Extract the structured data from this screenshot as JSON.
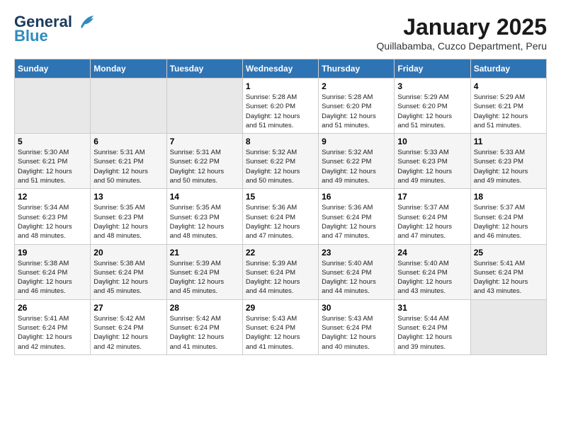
{
  "header": {
    "logo_line1": "General",
    "logo_line2": "Blue",
    "title": "January 2025",
    "subtitle": "Quillabamba, Cuzco Department, Peru"
  },
  "days_of_week": [
    "Sunday",
    "Monday",
    "Tuesday",
    "Wednesday",
    "Thursday",
    "Friday",
    "Saturday"
  ],
  "weeks": [
    [
      {
        "day": "",
        "info": ""
      },
      {
        "day": "",
        "info": ""
      },
      {
        "day": "",
        "info": ""
      },
      {
        "day": "1",
        "info": "Sunrise: 5:28 AM\nSunset: 6:20 PM\nDaylight: 12 hours\nand 51 minutes."
      },
      {
        "day": "2",
        "info": "Sunrise: 5:28 AM\nSunset: 6:20 PM\nDaylight: 12 hours\nand 51 minutes."
      },
      {
        "day": "3",
        "info": "Sunrise: 5:29 AM\nSunset: 6:20 PM\nDaylight: 12 hours\nand 51 minutes."
      },
      {
        "day": "4",
        "info": "Sunrise: 5:29 AM\nSunset: 6:21 PM\nDaylight: 12 hours\nand 51 minutes."
      }
    ],
    [
      {
        "day": "5",
        "info": "Sunrise: 5:30 AM\nSunset: 6:21 PM\nDaylight: 12 hours\nand 51 minutes."
      },
      {
        "day": "6",
        "info": "Sunrise: 5:31 AM\nSunset: 6:21 PM\nDaylight: 12 hours\nand 50 minutes."
      },
      {
        "day": "7",
        "info": "Sunrise: 5:31 AM\nSunset: 6:22 PM\nDaylight: 12 hours\nand 50 minutes."
      },
      {
        "day": "8",
        "info": "Sunrise: 5:32 AM\nSunset: 6:22 PM\nDaylight: 12 hours\nand 50 minutes."
      },
      {
        "day": "9",
        "info": "Sunrise: 5:32 AM\nSunset: 6:22 PM\nDaylight: 12 hours\nand 49 minutes."
      },
      {
        "day": "10",
        "info": "Sunrise: 5:33 AM\nSunset: 6:23 PM\nDaylight: 12 hours\nand 49 minutes."
      },
      {
        "day": "11",
        "info": "Sunrise: 5:33 AM\nSunset: 6:23 PM\nDaylight: 12 hours\nand 49 minutes."
      }
    ],
    [
      {
        "day": "12",
        "info": "Sunrise: 5:34 AM\nSunset: 6:23 PM\nDaylight: 12 hours\nand 48 minutes."
      },
      {
        "day": "13",
        "info": "Sunrise: 5:35 AM\nSunset: 6:23 PM\nDaylight: 12 hours\nand 48 minutes."
      },
      {
        "day": "14",
        "info": "Sunrise: 5:35 AM\nSunset: 6:23 PM\nDaylight: 12 hours\nand 48 minutes."
      },
      {
        "day": "15",
        "info": "Sunrise: 5:36 AM\nSunset: 6:24 PM\nDaylight: 12 hours\nand 47 minutes."
      },
      {
        "day": "16",
        "info": "Sunrise: 5:36 AM\nSunset: 6:24 PM\nDaylight: 12 hours\nand 47 minutes."
      },
      {
        "day": "17",
        "info": "Sunrise: 5:37 AM\nSunset: 6:24 PM\nDaylight: 12 hours\nand 47 minutes."
      },
      {
        "day": "18",
        "info": "Sunrise: 5:37 AM\nSunset: 6:24 PM\nDaylight: 12 hours\nand 46 minutes."
      }
    ],
    [
      {
        "day": "19",
        "info": "Sunrise: 5:38 AM\nSunset: 6:24 PM\nDaylight: 12 hours\nand 46 minutes."
      },
      {
        "day": "20",
        "info": "Sunrise: 5:38 AM\nSunset: 6:24 PM\nDaylight: 12 hours\nand 45 minutes."
      },
      {
        "day": "21",
        "info": "Sunrise: 5:39 AM\nSunset: 6:24 PM\nDaylight: 12 hours\nand 45 minutes."
      },
      {
        "day": "22",
        "info": "Sunrise: 5:39 AM\nSunset: 6:24 PM\nDaylight: 12 hours\nand 44 minutes."
      },
      {
        "day": "23",
        "info": "Sunrise: 5:40 AM\nSunset: 6:24 PM\nDaylight: 12 hours\nand 44 minutes."
      },
      {
        "day": "24",
        "info": "Sunrise: 5:40 AM\nSunset: 6:24 PM\nDaylight: 12 hours\nand 43 minutes."
      },
      {
        "day": "25",
        "info": "Sunrise: 5:41 AM\nSunset: 6:24 PM\nDaylight: 12 hours\nand 43 minutes."
      }
    ],
    [
      {
        "day": "26",
        "info": "Sunrise: 5:41 AM\nSunset: 6:24 PM\nDaylight: 12 hours\nand 42 minutes."
      },
      {
        "day": "27",
        "info": "Sunrise: 5:42 AM\nSunset: 6:24 PM\nDaylight: 12 hours\nand 42 minutes."
      },
      {
        "day": "28",
        "info": "Sunrise: 5:42 AM\nSunset: 6:24 PM\nDaylight: 12 hours\nand 41 minutes."
      },
      {
        "day": "29",
        "info": "Sunrise: 5:43 AM\nSunset: 6:24 PM\nDaylight: 12 hours\nand 41 minutes."
      },
      {
        "day": "30",
        "info": "Sunrise: 5:43 AM\nSunset: 6:24 PM\nDaylight: 12 hours\nand 40 minutes."
      },
      {
        "day": "31",
        "info": "Sunrise: 5:44 AM\nSunset: 6:24 PM\nDaylight: 12 hours\nand 39 minutes."
      },
      {
        "day": "",
        "info": ""
      }
    ]
  ]
}
